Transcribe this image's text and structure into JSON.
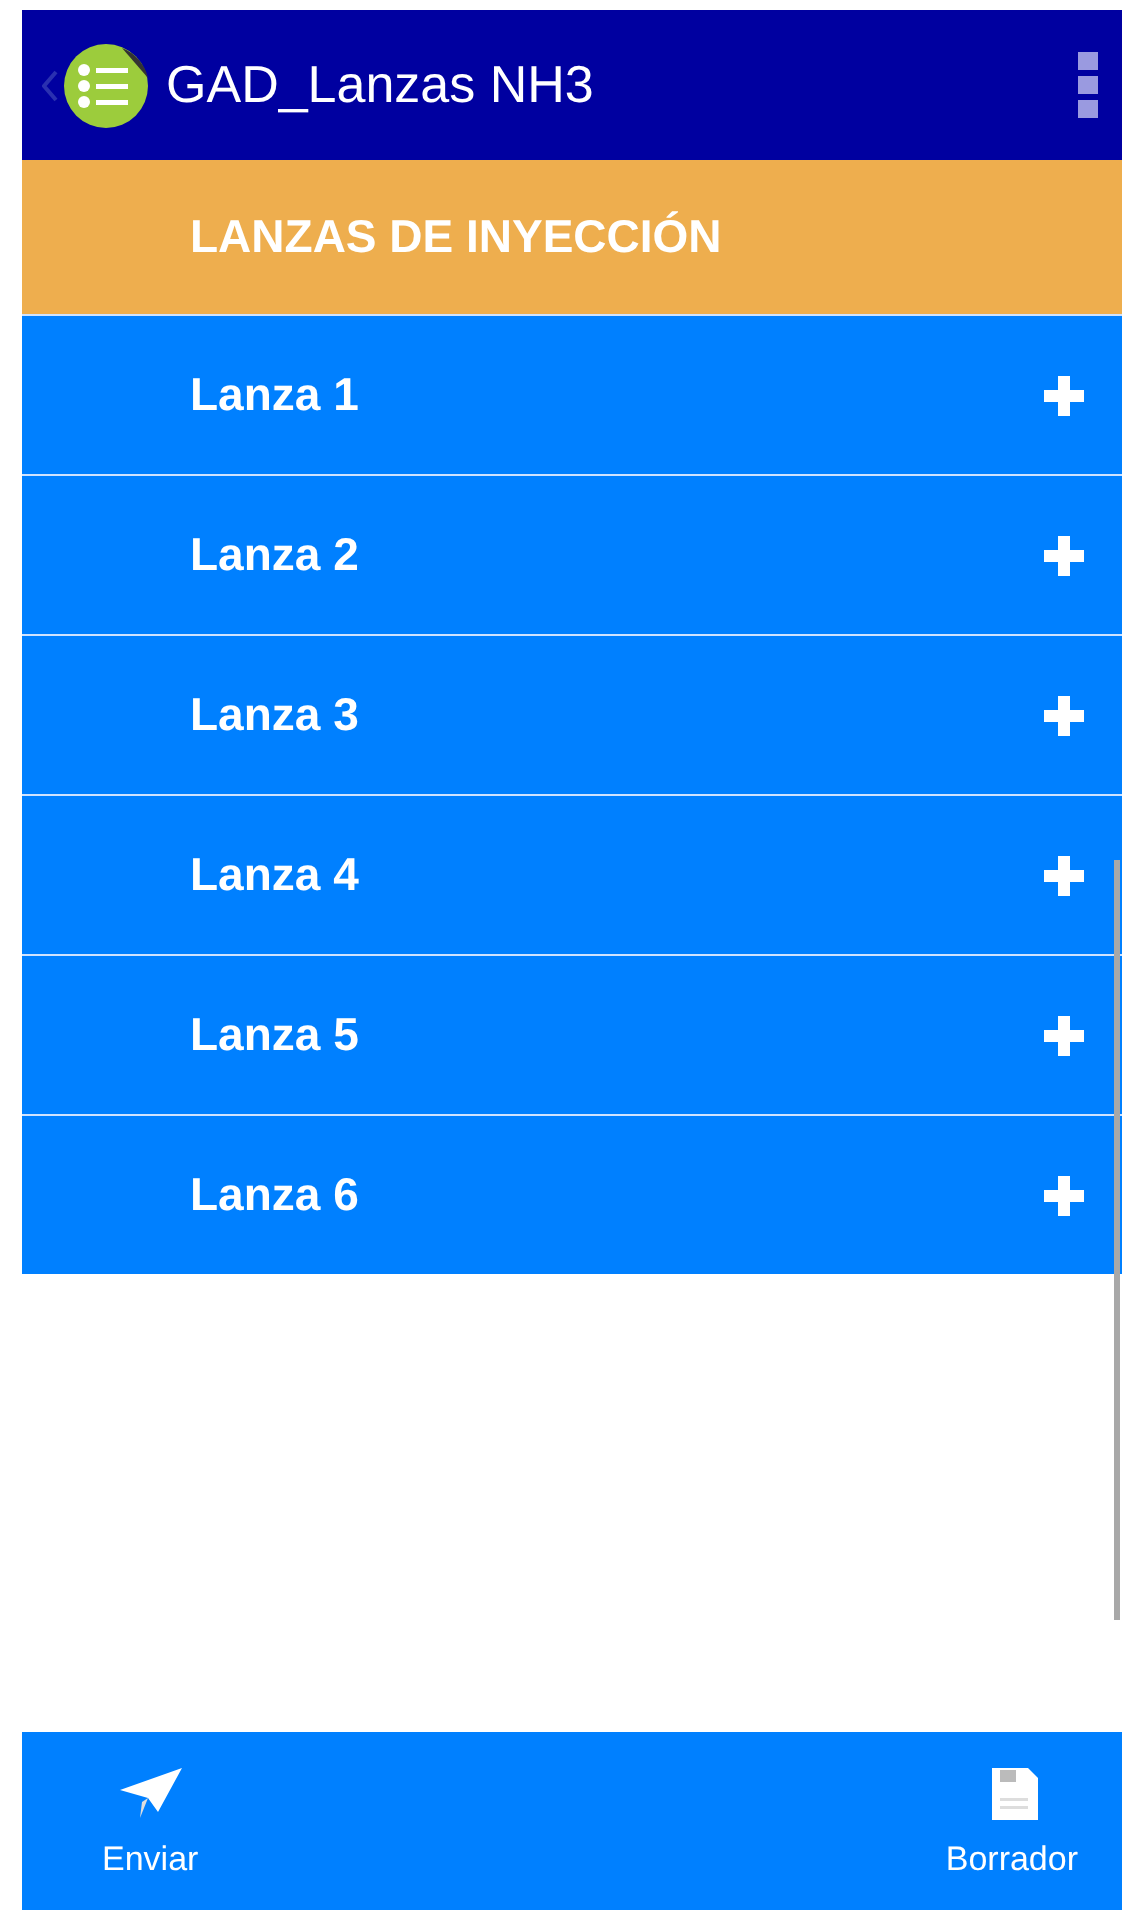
{
  "app_bar": {
    "title": "GAD_Lanzas NH3"
  },
  "section_header": {
    "title": "LANZAS DE INYECCIÓN"
  },
  "items": [
    {
      "label": "Lanza 1",
      "expanded": false
    },
    {
      "label": "Lanza 2",
      "expanded": false
    },
    {
      "label": "Lanza 3",
      "expanded": false
    },
    {
      "label": "Lanza 4",
      "expanded": false
    },
    {
      "label": "Lanza 5",
      "expanded": false
    },
    {
      "label": "Lanza 6",
      "expanded": false
    }
  ],
  "bottom_bar": [
    {
      "kind": "send",
      "label": "Enviar"
    },
    {
      "kind": "save",
      "label": "Borrador"
    }
  ]
}
